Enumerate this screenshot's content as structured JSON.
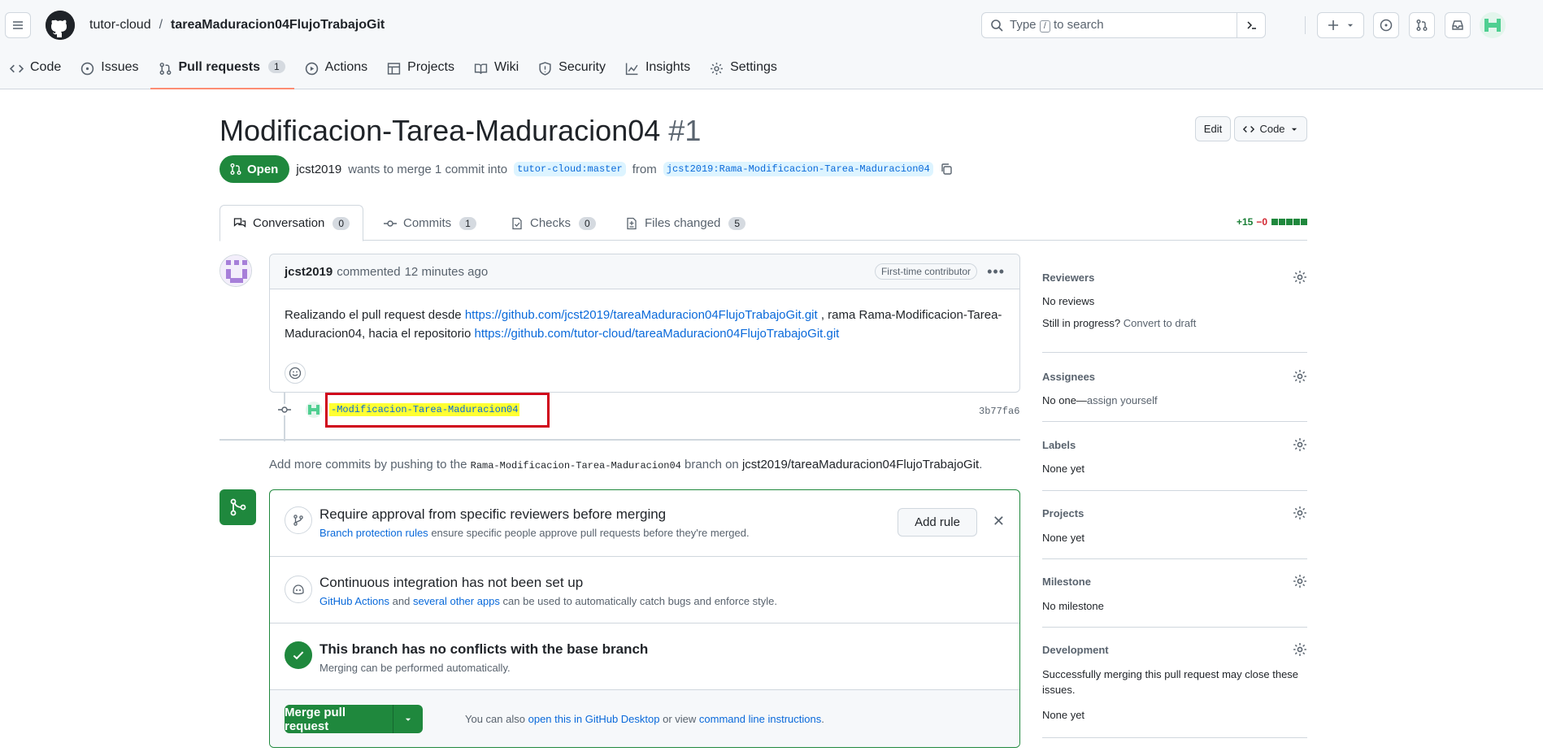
{
  "header": {
    "owner": "tutor-cloud",
    "separator": "/",
    "repo": "tareaMaduracion04FlujoTrabajoGit",
    "search_prefix": "Type",
    "search_key": "/",
    "search_suffix": "to search"
  },
  "repo_tabs": [
    {
      "label": "Code",
      "icon": "code-icon"
    },
    {
      "label": "Issues",
      "icon": "issue-icon"
    },
    {
      "label": "Pull requests",
      "icon": "pull-request-icon",
      "count": "1"
    },
    {
      "label": "Actions",
      "icon": "play-icon"
    },
    {
      "label": "Projects",
      "icon": "table-icon"
    },
    {
      "label": "Wiki",
      "icon": "book-icon"
    },
    {
      "label": "Security",
      "icon": "shield-icon"
    },
    {
      "label": "Insights",
      "icon": "graph-icon"
    },
    {
      "label": "Settings",
      "icon": "gear-icon"
    }
  ],
  "pr": {
    "title": "Modificacion-Tarea-Maduracion04",
    "number": "#1",
    "edit_label": "Edit",
    "code_label": "Code",
    "state": "Open",
    "author": "jcst2019",
    "merge_text_1": "wants to merge 1 commit into",
    "base_branch": "tutor-cloud:master",
    "from_text": "from",
    "head_branch": "jcst2019:Rama-Modificacion-Tarea-Maduracion04"
  },
  "pr_tabs": [
    {
      "label": "Conversation",
      "count": "0"
    },
    {
      "label": "Commits",
      "count": "1"
    },
    {
      "label": "Checks",
      "count": "0"
    },
    {
      "label": "Files changed",
      "count": "5"
    }
  ],
  "diffstat": {
    "added": "+15",
    "removed": "−0"
  },
  "comment": {
    "author": "jcst2019",
    "action": "commented",
    "time": "12 minutes ago",
    "badge": "First-time contributor",
    "text_1": "Realizando el pull request desde",
    "link_1": "https://github.com/jcst2019/tareaMaduracion04FlujoTrabajoGit.git",
    "text_2": ", rama Rama-Modificacion-Tarea-Maduracion04, hacia el repositorio",
    "link_2": "https://github.com/tutor-cloud/tareaMaduracion04FlujoTrabajoGit.git"
  },
  "commit": {
    "message": "-Modificacion-Tarea-Maduracion04",
    "sha": "3b77fa6"
  },
  "more_commits": {
    "text_1": "Add more commits by pushing to the",
    "branch": "Rama-Modificacion-Tarea-Maduracion04",
    "text_2": "branch on",
    "repo": "jcst2019/tareaMaduracion04FlujoTrabajoGit",
    "period": "."
  },
  "merge": {
    "rule_title": "Require approval from specific reviewers before merging",
    "rule_link": "Branch protection rules",
    "rule_text": "ensure specific people approve pull requests before they're merged.",
    "add_rule": "Add rule",
    "ci_title": "Continuous integration has not been set up",
    "ci_link_1": "GitHub Actions",
    "ci_and": "and",
    "ci_link_2": "several other apps",
    "ci_text": "can be used to automatically catch bugs and enforce style.",
    "conflict_title": "This branch has no conflicts with the base branch",
    "conflict_text": "Merging can be performed automatically.",
    "merge_button": "Merge pull request",
    "also_text": "You can also",
    "desktop_link": "open this in GitHub Desktop",
    "or_view": "or view",
    "cli_link": "command line instructions",
    "period": "."
  },
  "sidebar": {
    "reviewers": {
      "heading": "Reviewers",
      "value": "No reviews",
      "progress": "Still in progress?",
      "draft_link": "Convert to draft"
    },
    "assignees": {
      "heading": "Assignees",
      "value": "No one—",
      "link": "assign yourself"
    },
    "labels": {
      "heading": "Labels",
      "value": "None yet"
    },
    "projects": {
      "heading": "Projects",
      "value": "None yet"
    },
    "milestone": {
      "heading": "Milestone",
      "value": "No milestone"
    },
    "development": {
      "heading": "Development",
      "text": "Successfully merging this pull request may close these issues.",
      "value": "None yet"
    }
  },
  "colors": {
    "accent": "#1f883d",
    "link": "#0969da",
    "highlight": "#ffff33",
    "annotation": "#d0021b"
  }
}
